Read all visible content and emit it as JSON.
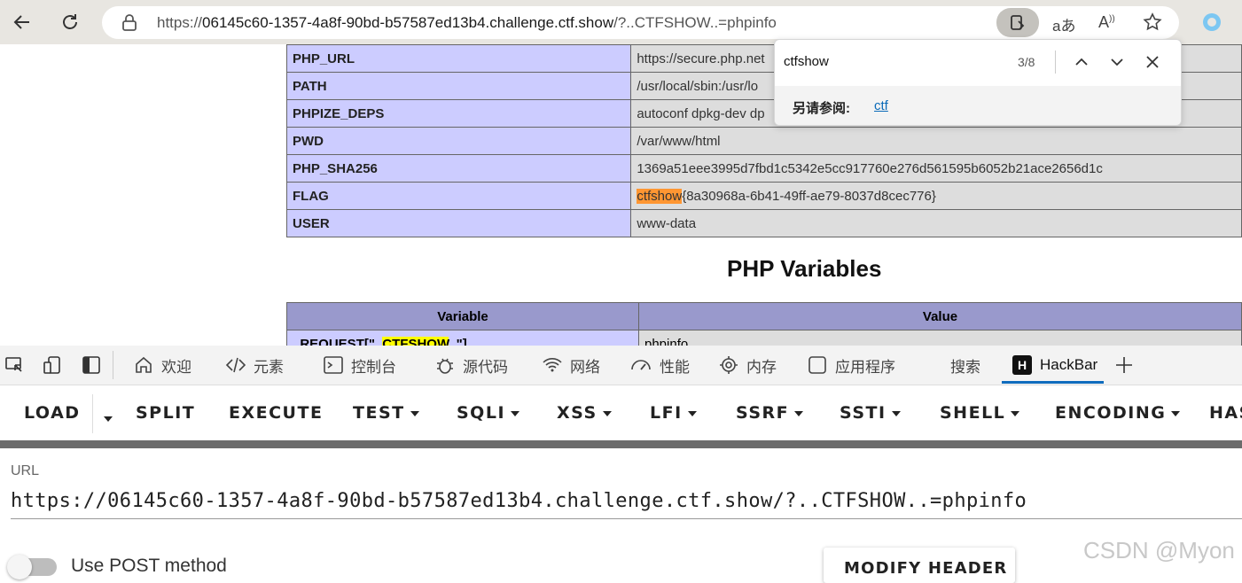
{
  "browser": {
    "url_prefix": "https://",
    "url_host": "06145c60-1357-4a8f-90bd-b57587ed13b4.challenge.ctf.show",
    "url_path": "/?..CTFSHOW..=phpinfo"
  },
  "find": {
    "query": "ctfshow",
    "count": "3/8",
    "see_also_label": "另请参阅:",
    "see_also_link": "ctf"
  },
  "env_table": [
    {
      "key": "PHP_URL",
      "value": "https://secure.php.net"
    },
    {
      "key": "PATH",
      "value": "/usr/local/sbin:/usr/lo"
    },
    {
      "key": "PHPIZE_DEPS",
      "value": "autoconf dpkg-dev dp"
    },
    {
      "key": "PWD",
      "value": "/var/www/html"
    },
    {
      "key": "PHP_SHA256",
      "value": "1369a51eee3995d7fbd1c5342e5cc917760e276d561595b6052b21ace2656d1c"
    },
    {
      "key": "FLAG",
      "value_highlight": "ctfshow",
      "value_rest": "{8a30968a-6b41-49ff-ae79-8037d8cec776}"
    },
    {
      "key": "USER",
      "value": "www-data"
    }
  ],
  "php_variables": {
    "title": "PHP Variables",
    "header_variable": "Variable",
    "header_value": "Value",
    "row_key_prefix": "_REQUEST[\"..",
    "row_key_highlight": "CTFSHOW",
    "row_key_suffix": "..\"]",
    "row_value": "phpinfo"
  },
  "devtools": {
    "tabs": [
      "欢迎",
      "元素",
      "控制台",
      "源代码",
      "网络",
      "性能",
      "内存",
      "应用程序",
      "搜索",
      "HackBar"
    ],
    "active_tab": "HackBar"
  },
  "hackbar": {
    "menu": [
      "LOAD",
      "SPLIT",
      "EXECUTE",
      "TEST",
      "SQLI",
      "XSS",
      "LFI",
      "SSRF",
      "SSTI",
      "SHELL",
      "ENCODING",
      "HAS"
    ],
    "url_label": "URL",
    "url_value": "https://06145c60-1357-4a8f-90bd-b57587ed13b4.challenge.ctf.show/?..CTFSHOW..=phpinfo",
    "post_label": "Use POST method",
    "post_enabled": false,
    "modify_header": "MODIFY HEADER"
  },
  "watermark": "CSDN @Myon",
  "colors": {
    "browser_bar": "#e8e6e1",
    "env_key_bg": "#ccccff",
    "env_value_bg": "#dddddd",
    "header_bg": "#9999cc",
    "find_highlight": "#ff9632",
    "match_highlight": "#ffff00",
    "active_tab_accent": "#0f6cbd"
  }
}
